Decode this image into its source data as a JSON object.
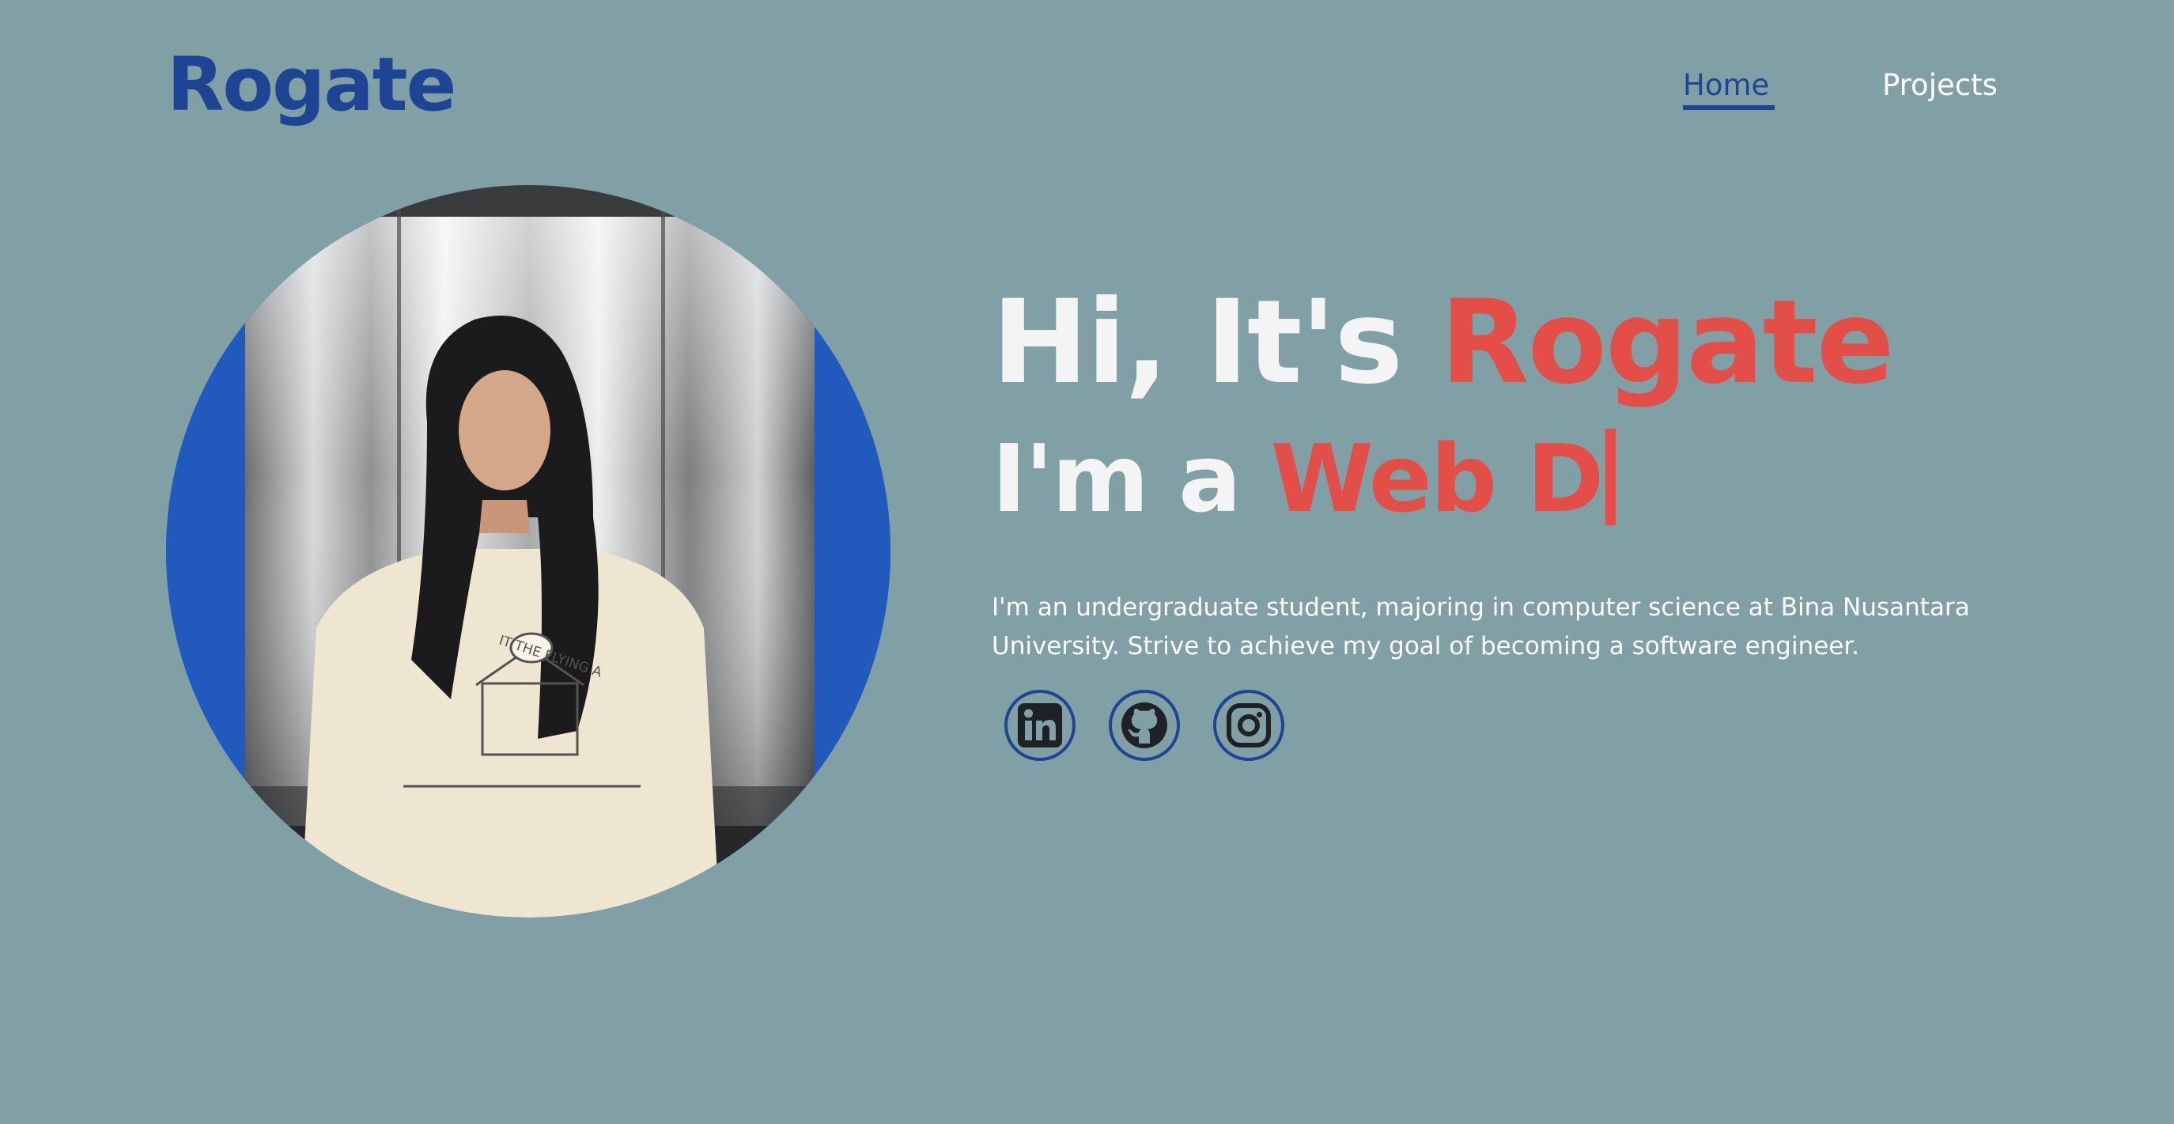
{
  "header": {
    "logo": "Rogate",
    "nav": {
      "home": "Home",
      "projects": "Projects"
    }
  },
  "hero": {
    "greeting": "Hi, It's",
    "name": "Rogate",
    "role_prefix": "I'm a",
    "role_typed": "Web D",
    "bio": "I'm an undergraduate student, majoring in computer science at Bina Nusantara University. Strive to achieve my goal of becoming a software engineer.",
    "shirt_print": "IT THE FLYING A"
  },
  "socials": [
    {
      "icon": "linkedin-icon"
    },
    {
      "icon": "github-icon"
    },
    {
      "icon": "instagram-icon"
    }
  ],
  "colors": {
    "background": "#81a0a6",
    "brand_blue": "#1d4593",
    "accent_red": "#e34e49",
    "text_white": "#ffffff"
  }
}
